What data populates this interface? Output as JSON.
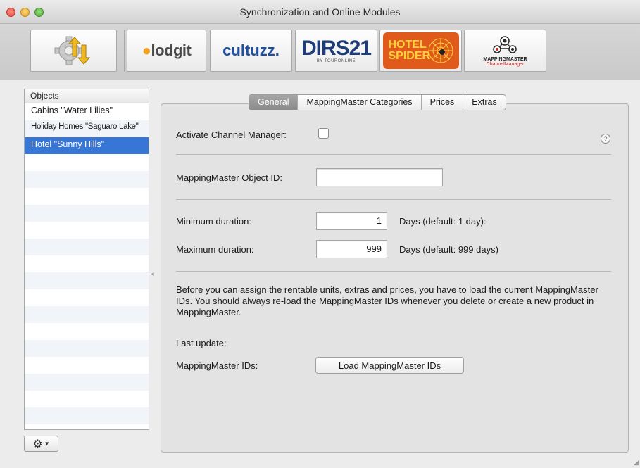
{
  "window": {
    "title": "Synchronization and Online Modules"
  },
  "toolbar": {
    "items": [
      {
        "name": "sync-settings",
        "label": ""
      },
      {
        "name": "lodgit",
        "label": "lodgit"
      },
      {
        "name": "cultuzz",
        "label": "cultuzz."
      },
      {
        "name": "dirs21",
        "label": "DIRS21",
        "sublabel": "BY TOURONLINE"
      },
      {
        "name": "hotel-spider",
        "label_line1": "HOTEL",
        "label_line2": "SPIDER"
      },
      {
        "name": "mappingmaster",
        "label_line1": "MAPPINGMASTER",
        "label_line2": "ChannelManager"
      }
    ]
  },
  "objects": {
    "header": "Objects",
    "items": [
      "Cabins \"Water Lilies\"",
      "Holiday Homes \"Saguaro Lake\"",
      "Hotel \"Sunny Hills\""
    ],
    "selected_index": 2
  },
  "tabs": [
    "General",
    "MappingMaster Categories",
    "Prices",
    "Extras"
  ],
  "active_tab": "General",
  "general": {
    "activate_label": "Activate Channel Manager:",
    "activate_checked": false,
    "help_symbol": "?",
    "object_id_label": "MappingMaster Object ID:",
    "object_id_value": "",
    "min_label": "Minimum duration:",
    "min_value": "1",
    "min_hint": "Days (default: 1 day):",
    "max_label": "Maximum duration:",
    "max_value": "999",
    "max_hint": "Days (default: 999 days)",
    "description": "Before you can assign the rentable units, extras and prices, you have to load the current MappingMaster IDs. You should always re-load the MappingMaster IDs whenever you delete or create a new product in MappingMaster.",
    "last_update_label": "Last update:",
    "ids_label": "MappingMaster IDs:",
    "load_button": "Load MappingMaster IDs"
  }
}
